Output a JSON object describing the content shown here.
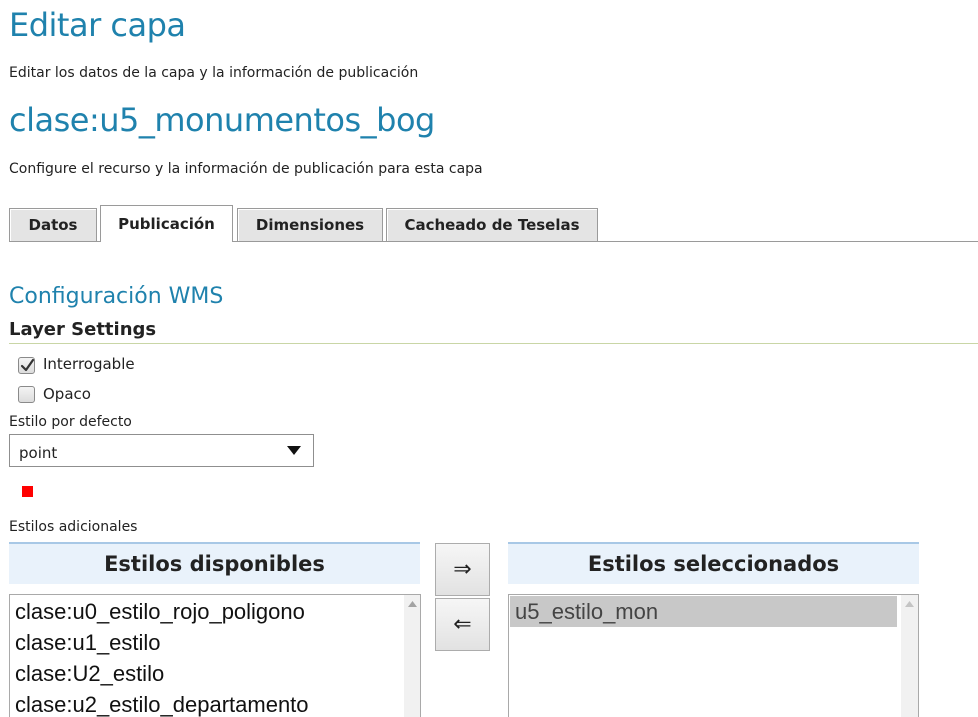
{
  "page": {
    "title": "Editar capa",
    "description": "Editar los datos de la capa y la información de publicación",
    "layer_name": "clase:u5_monumentos_bog",
    "layer_description": "Configure el recurso y la información de publicación para esta capa"
  },
  "tabs": [
    {
      "label": "Datos",
      "active": false
    },
    {
      "label": "Publicación",
      "active": true
    },
    {
      "label": "Dimensiones",
      "active": false
    },
    {
      "label": "Cacheado de Teselas",
      "active": false
    }
  ],
  "wms": {
    "section_title": "Configuración WMS",
    "layer_settings_title": "Layer Settings",
    "queryable": {
      "label": "Interrogable",
      "checked": true
    },
    "opaque": {
      "label": "Opaco",
      "checked": false
    },
    "default_style": {
      "label": "Estilo por defecto",
      "value": "point",
      "preview_color": "#ff0000"
    },
    "additional_styles": {
      "label": "Estilos adicionales",
      "available_header": "Estilos disponibles",
      "selected_header": "Estilos seleccionados",
      "add_button": "⇒",
      "remove_button": "⇐",
      "available": [
        "clase:u0_estilo_rojo_poligono",
        "clase:u1_estilo",
        "clase:U2_estilo",
        "clase:u2_estilo_departamento"
      ],
      "selected": [
        "u5_estilo_mon"
      ]
    }
  },
  "colors": {
    "accent": "#1f82ad",
    "header_bg": "#e9f2fb",
    "selected_item_bg": "#c8c8c8"
  }
}
